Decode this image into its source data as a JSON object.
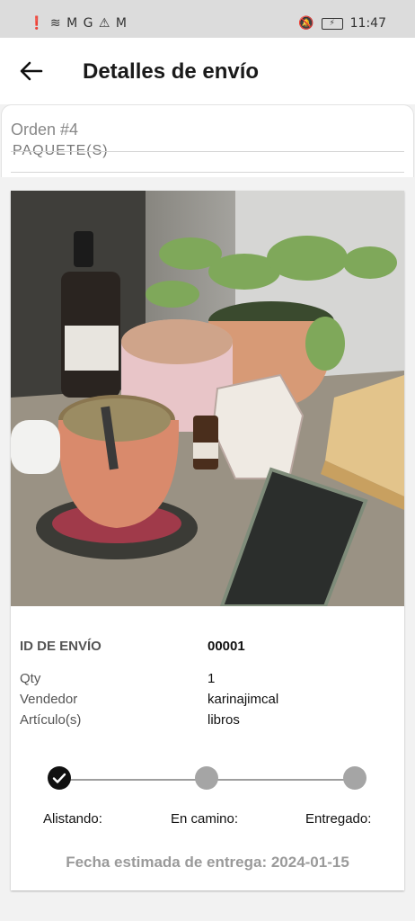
{
  "status_bar": {
    "left_icons": "❗ ≋ M G ⚠ M",
    "time": "11:47",
    "battery_glyph": "⚡"
  },
  "header": {
    "title": "Detalles de envío",
    "back_icon": "arrow-left-icon"
  },
  "order": {
    "title": "Orden #4",
    "cut_label": "PAQUETE(S)"
  },
  "shipment": {
    "fields": [
      {
        "label": "ID DE ENVÍO",
        "value": "00001"
      },
      {
        "label": "Qty",
        "value": "1"
      },
      {
        "label": "Vendedor",
        "value": "karinajimcal"
      },
      {
        "label": "Artículo(s)",
        "value": "libros"
      }
    ]
  },
  "tracker": {
    "steps": [
      {
        "label": "Alistando:",
        "state": "done"
      },
      {
        "label": "En camino:",
        "state": "pending"
      },
      {
        "label": "Entregado:",
        "state": "pending"
      }
    ]
  },
  "eta": "Fecha estimada de entrega: 2024-01-15",
  "colors": {
    "done": "#111111",
    "pending": "#a5a5a5",
    "muted_text": "#9a9a9a"
  }
}
